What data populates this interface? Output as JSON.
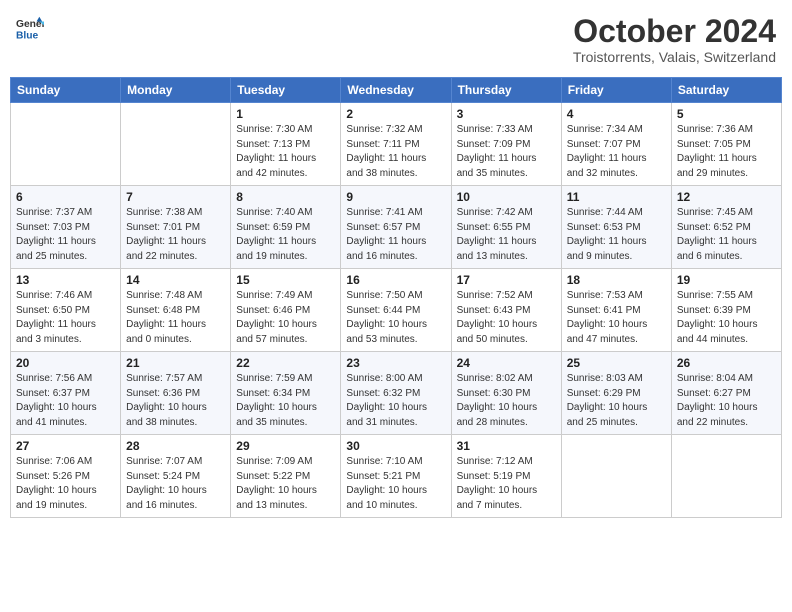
{
  "header": {
    "logo_general": "General",
    "logo_blue": "Blue",
    "month_title": "October 2024",
    "subtitle": "Troistorrents, Valais, Switzerland"
  },
  "days_of_week": [
    "Sunday",
    "Monday",
    "Tuesday",
    "Wednesday",
    "Thursday",
    "Friday",
    "Saturday"
  ],
  "weeks": [
    [
      {
        "day": "",
        "info": ""
      },
      {
        "day": "",
        "info": ""
      },
      {
        "day": "1",
        "info": "Sunrise: 7:30 AM\nSunset: 7:13 PM\nDaylight: 11 hours and 42 minutes."
      },
      {
        "day": "2",
        "info": "Sunrise: 7:32 AM\nSunset: 7:11 PM\nDaylight: 11 hours and 38 minutes."
      },
      {
        "day": "3",
        "info": "Sunrise: 7:33 AM\nSunset: 7:09 PM\nDaylight: 11 hours and 35 minutes."
      },
      {
        "day": "4",
        "info": "Sunrise: 7:34 AM\nSunset: 7:07 PM\nDaylight: 11 hours and 32 minutes."
      },
      {
        "day": "5",
        "info": "Sunrise: 7:36 AM\nSunset: 7:05 PM\nDaylight: 11 hours and 29 minutes."
      }
    ],
    [
      {
        "day": "6",
        "info": "Sunrise: 7:37 AM\nSunset: 7:03 PM\nDaylight: 11 hours and 25 minutes."
      },
      {
        "day": "7",
        "info": "Sunrise: 7:38 AM\nSunset: 7:01 PM\nDaylight: 11 hours and 22 minutes."
      },
      {
        "day": "8",
        "info": "Sunrise: 7:40 AM\nSunset: 6:59 PM\nDaylight: 11 hours and 19 minutes."
      },
      {
        "day": "9",
        "info": "Sunrise: 7:41 AM\nSunset: 6:57 PM\nDaylight: 11 hours and 16 minutes."
      },
      {
        "day": "10",
        "info": "Sunrise: 7:42 AM\nSunset: 6:55 PM\nDaylight: 11 hours and 13 minutes."
      },
      {
        "day": "11",
        "info": "Sunrise: 7:44 AM\nSunset: 6:53 PM\nDaylight: 11 hours and 9 minutes."
      },
      {
        "day": "12",
        "info": "Sunrise: 7:45 AM\nSunset: 6:52 PM\nDaylight: 11 hours and 6 minutes."
      }
    ],
    [
      {
        "day": "13",
        "info": "Sunrise: 7:46 AM\nSunset: 6:50 PM\nDaylight: 11 hours and 3 minutes."
      },
      {
        "day": "14",
        "info": "Sunrise: 7:48 AM\nSunset: 6:48 PM\nDaylight: 11 hours and 0 minutes."
      },
      {
        "day": "15",
        "info": "Sunrise: 7:49 AM\nSunset: 6:46 PM\nDaylight: 10 hours and 57 minutes."
      },
      {
        "day": "16",
        "info": "Sunrise: 7:50 AM\nSunset: 6:44 PM\nDaylight: 10 hours and 53 minutes."
      },
      {
        "day": "17",
        "info": "Sunrise: 7:52 AM\nSunset: 6:43 PM\nDaylight: 10 hours and 50 minutes."
      },
      {
        "day": "18",
        "info": "Sunrise: 7:53 AM\nSunset: 6:41 PM\nDaylight: 10 hours and 47 minutes."
      },
      {
        "day": "19",
        "info": "Sunrise: 7:55 AM\nSunset: 6:39 PM\nDaylight: 10 hours and 44 minutes."
      }
    ],
    [
      {
        "day": "20",
        "info": "Sunrise: 7:56 AM\nSunset: 6:37 PM\nDaylight: 10 hours and 41 minutes."
      },
      {
        "day": "21",
        "info": "Sunrise: 7:57 AM\nSunset: 6:36 PM\nDaylight: 10 hours and 38 minutes."
      },
      {
        "day": "22",
        "info": "Sunrise: 7:59 AM\nSunset: 6:34 PM\nDaylight: 10 hours and 35 minutes."
      },
      {
        "day": "23",
        "info": "Sunrise: 8:00 AM\nSunset: 6:32 PM\nDaylight: 10 hours and 31 minutes."
      },
      {
        "day": "24",
        "info": "Sunrise: 8:02 AM\nSunset: 6:30 PM\nDaylight: 10 hours and 28 minutes."
      },
      {
        "day": "25",
        "info": "Sunrise: 8:03 AM\nSunset: 6:29 PM\nDaylight: 10 hours and 25 minutes."
      },
      {
        "day": "26",
        "info": "Sunrise: 8:04 AM\nSunset: 6:27 PM\nDaylight: 10 hours and 22 minutes."
      }
    ],
    [
      {
        "day": "27",
        "info": "Sunrise: 7:06 AM\nSunset: 5:26 PM\nDaylight: 10 hours and 19 minutes."
      },
      {
        "day": "28",
        "info": "Sunrise: 7:07 AM\nSunset: 5:24 PM\nDaylight: 10 hours and 16 minutes."
      },
      {
        "day": "29",
        "info": "Sunrise: 7:09 AM\nSunset: 5:22 PM\nDaylight: 10 hours and 13 minutes."
      },
      {
        "day": "30",
        "info": "Sunrise: 7:10 AM\nSunset: 5:21 PM\nDaylight: 10 hours and 10 minutes."
      },
      {
        "day": "31",
        "info": "Sunrise: 7:12 AM\nSunset: 5:19 PM\nDaylight: 10 hours and 7 minutes."
      },
      {
        "day": "",
        "info": ""
      },
      {
        "day": "",
        "info": ""
      }
    ]
  ]
}
